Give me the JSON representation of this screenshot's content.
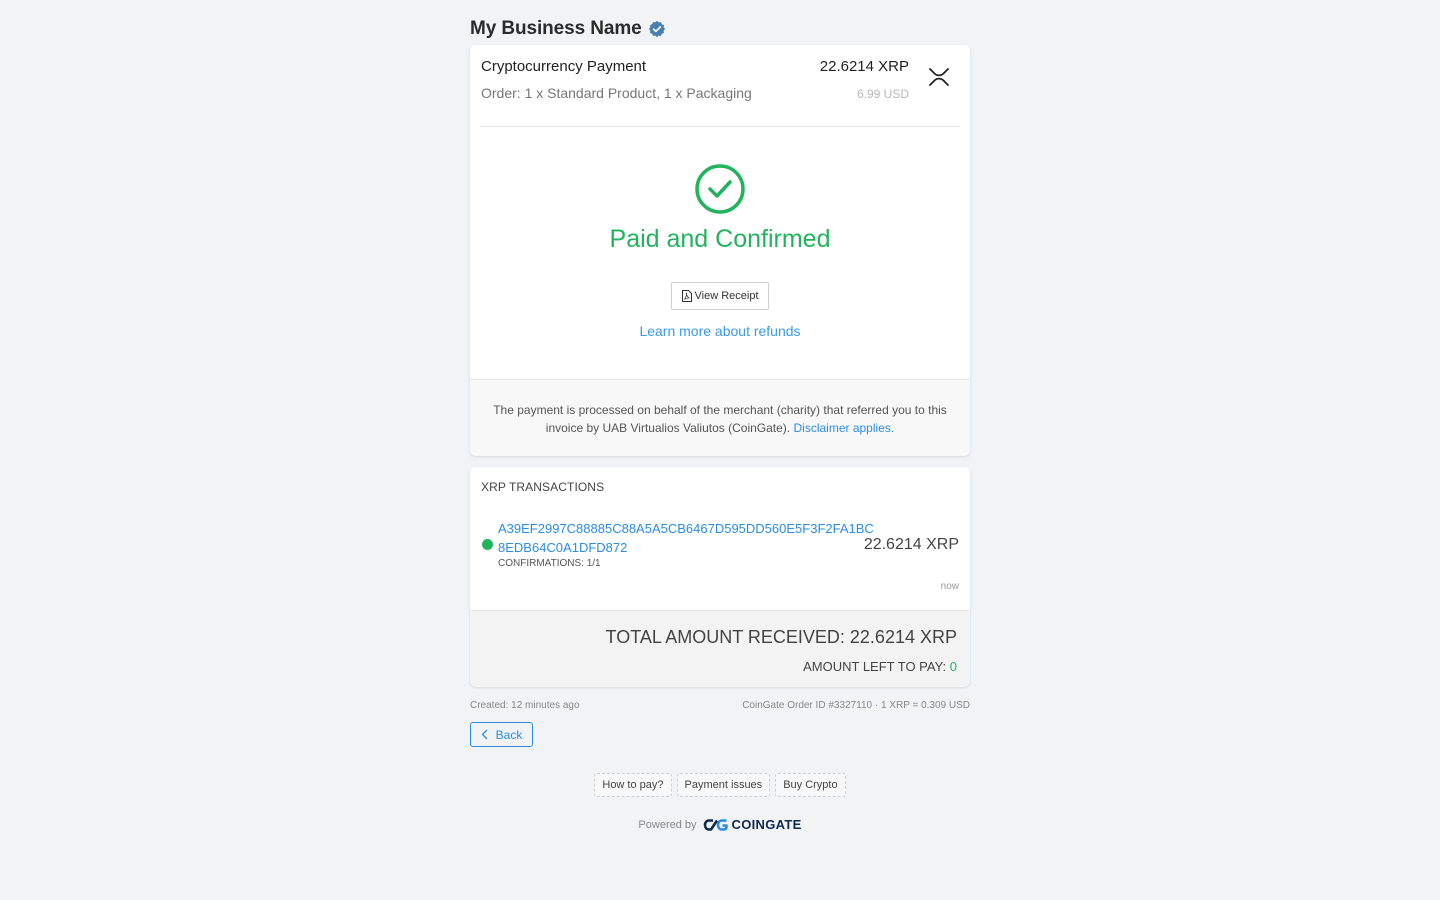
{
  "merchant": {
    "name": "My Business Name",
    "verified_icon": "verified-badge-icon"
  },
  "invoice": {
    "title": "Cryptocurrency Payment",
    "order_description": "Order: 1 x Standard Product, 1 x Packaging",
    "crypto_amount": "22.6214 XRP",
    "fiat_amount": "6.99 USD",
    "currency_icon": "xrp-icon"
  },
  "status": {
    "icon": "check-circle-icon",
    "text": "Paid and Confirmed",
    "color": "#22b35e",
    "receipt_button": "View Receipt",
    "receipt_icon": "pdf-file-icon",
    "refund_link": "Learn more about refunds"
  },
  "disclaimer": {
    "text": "The payment is processed on behalf of the merchant (charity) that referred you to this invoice by UAB Virtualios Valiutos (CoinGate).",
    "link": "Disclaimer applies."
  },
  "transactions": {
    "title": "XRP TRANSACTIONS",
    "items": [
      {
        "hash": "A39EF2997C88885C88A5A5CB6467D595DD560E5F3F2FA1BC8EDB64C0A1DFD872",
        "confirmations": "CONFIRMATIONS: 1/1",
        "amount": "22.6214 XRP",
        "time": "now",
        "status_color": "#22b35e"
      }
    ]
  },
  "totals": {
    "received_label": "TOTAL AMOUNT RECEIVED: 22.6214 XRP",
    "left_label": "AMOUNT LEFT TO PAY: ",
    "left_value": "0"
  },
  "meta": {
    "created": "Created: 12 minutes ago",
    "order_info": "CoinGate Order ID #3327110 · 1 XRP = 0.309 USD"
  },
  "nav": {
    "back_label": "Back"
  },
  "help_links": [
    "How to pay?",
    "Payment issues",
    "Buy Crypto"
  ],
  "footer": {
    "powered_by": "Powered by",
    "brand": "COINGATE"
  }
}
